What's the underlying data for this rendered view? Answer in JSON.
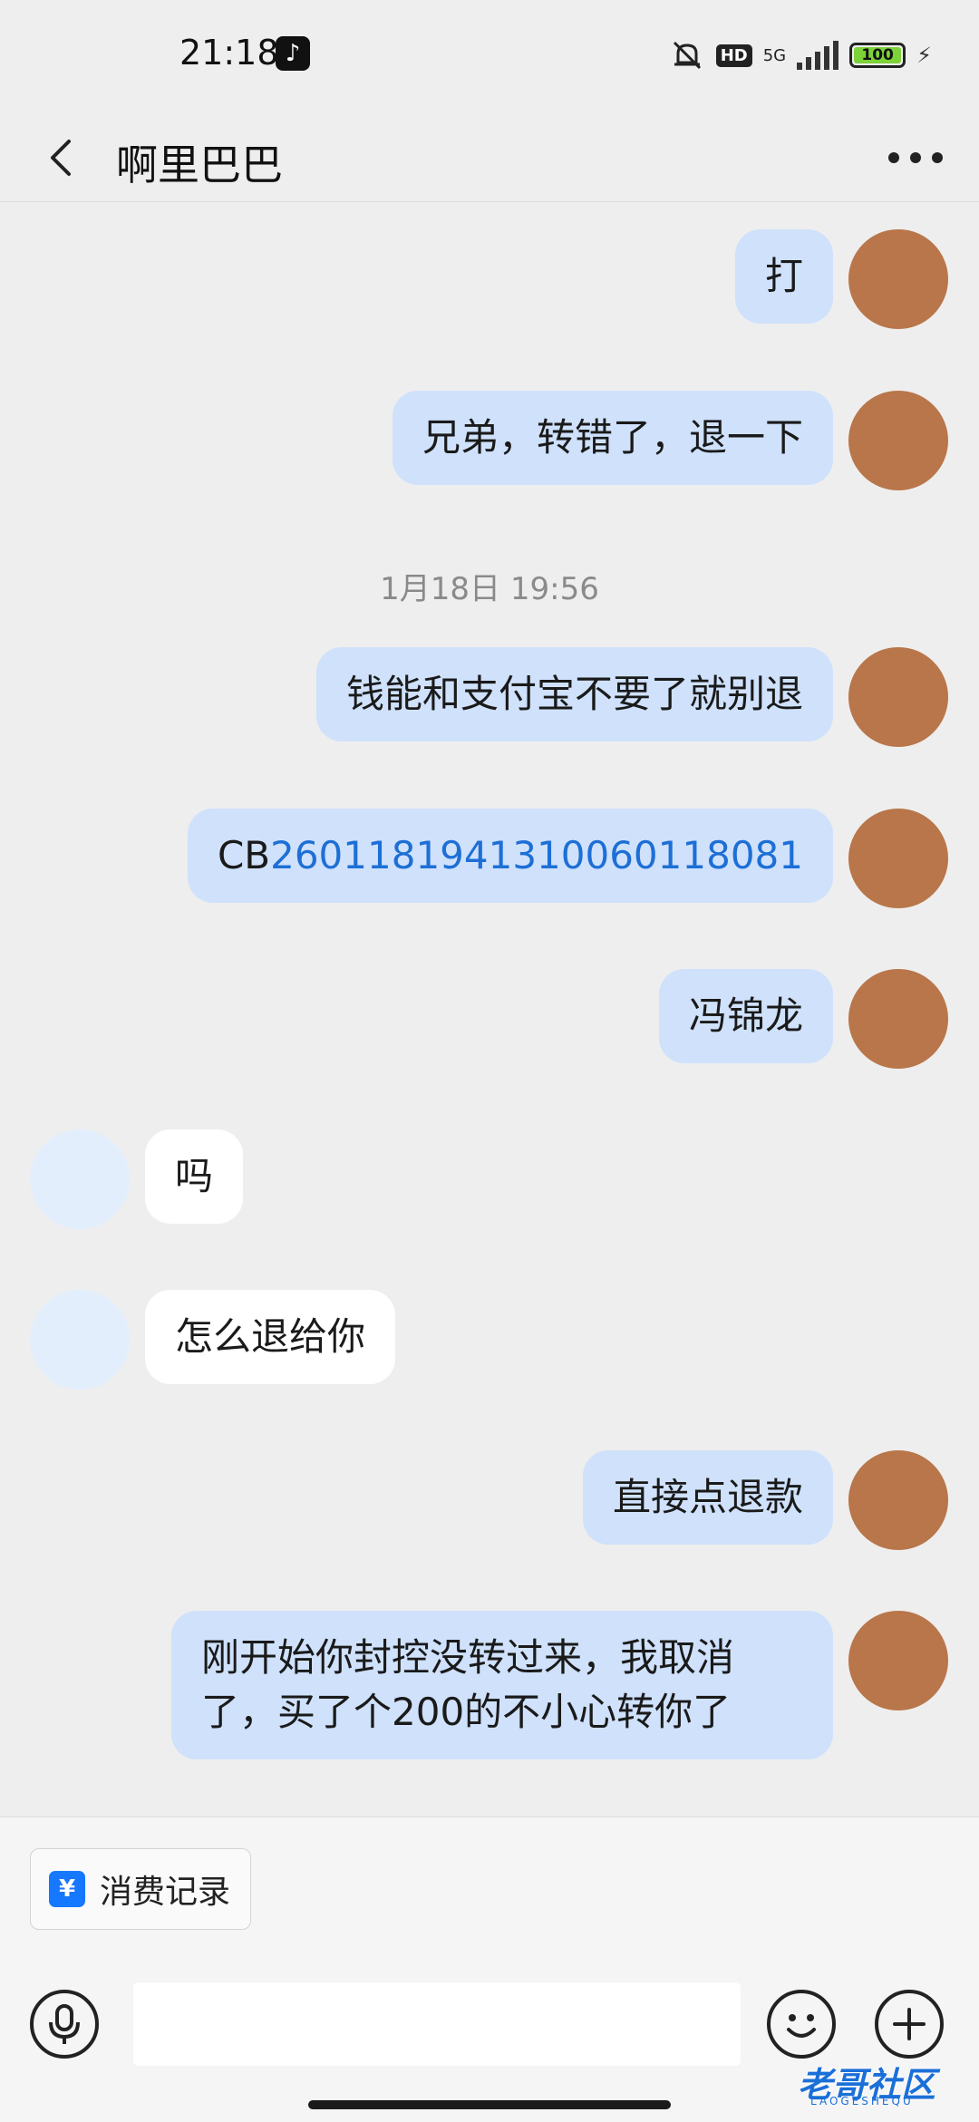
{
  "status_bar": {
    "time": "21:18",
    "app_icon": "tiktok-icon",
    "hd": "HD",
    "network": "5G",
    "battery": "100",
    "battery_percent": 100
  },
  "header": {
    "title": "啊里巴巴",
    "back_icon": "chevron-left-icon",
    "more_icon": "more-dots-icon"
  },
  "messages": [
    {
      "side": "out",
      "text": "打"
    },
    {
      "side": "out",
      "text": "兄弟，转错了，退一下"
    },
    {
      "side": "time",
      "text": "1月18日 19:56"
    },
    {
      "side": "out",
      "text": "钱能和支付宝不要了就别退"
    },
    {
      "side": "out",
      "prefix": "CB",
      "link": "2601181941310060118081"
    },
    {
      "side": "out",
      "text": "冯锦龙"
    },
    {
      "side": "in",
      "text": "吗"
    },
    {
      "side": "in",
      "text": "怎么退给你"
    },
    {
      "side": "out",
      "text": "直接点退款"
    },
    {
      "side": "out",
      "text": "刚开始你封控没转过来，我取消了，买了个200的不小心转你了"
    }
  ],
  "bottom": {
    "records_label": "消费记录",
    "records_icon_glyph": "¥",
    "input_value": "",
    "voice_icon": "microphone-icon",
    "emoji_icon": "smiley-icon",
    "plus_icon": "plus-icon"
  },
  "watermark": {
    "text": "老哥社区",
    "sub": "LAOGESHEQU"
  },
  "colors": {
    "outgoing_bubble": "#cfe1fb",
    "incoming_bubble": "#ffffff",
    "link": "#1d6fd6",
    "background": "#eeeeee"
  }
}
